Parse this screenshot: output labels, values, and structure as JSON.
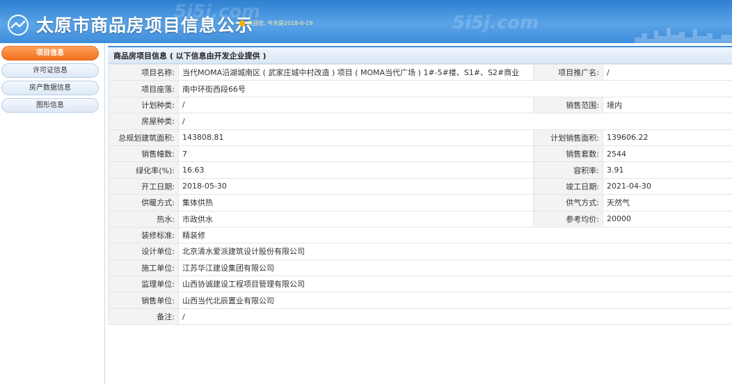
{
  "header": {
    "title": "太原市商品房项目信息公示",
    "welcome": "欢迎您, 今天是2018-6-19",
    "watermark": "5i5j.com"
  },
  "sidebar": {
    "items": [
      {
        "label": "项目信息",
        "active": true
      },
      {
        "label": "许可证信息",
        "active": false
      },
      {
        "label": "房产数据信息",
        "active": false
      },
      {
        "label": "图形信息",
        "active": false
      }
    ]
  },
  "main": {
    "section_title": "商品房项目信息 ( 以下信息由开发企业提供 )",
    "rows": [
      {
        "l1": "项目名称:",
        "v1": "当代MOMA沿湖城南区 ( 武家庄城中村改造 ) 项目 ( MOMA当代广场 ) 1#-5#楼、S1#、S2#商业",
        "l2": "项目推广名:",
        "v2": "/"
      },
      {
        "l1": "项目座落:",
        "v1": "南中环街西段66号"
      },
      {
        "l1": "计划种类:",
        "v1": "/",
        "l2": "销售范围:",
        "v2": "境内"
      },
      {
        "l1": "房屋种类:",
        "v1": "/"
      },
      {
        "l1": "总规划建筑面积:",
        "v1": "143808.81",
        "l2": "计划销售面积:",
        "v2": "139606.22"
      },
      {
        "l1": "销售幢数:",
        "v1": "7",
        "l2": "销售套数:",
        "v2": "2544"
      },
      {
        "l1": "绿化率(%):",
        "v1": "16.63",
        "l2": "容积率:",
        "v2": "3.91"
      },
      {
        "l1": "开工日期:",
        "v1": "2018-05-30",
        "l2": "竣工日期:",
        "v2": "2021-04-30"
      },
      {
        "l1": "供暖方式:",
        "v1": "集体供热",
        "l2": "供气方式:",
        "v2": "天然气"
      },
      {
        "l1": "热水:",
        "v1": "市政供水",
        "l2": "参考均价:",
        "v2": "20000"
      },
      {
        "l1": "装修标准:",
        "v1": "精装修"
      },
      {
        "l1": "设计单位:",
        "v1": "北京清水爱派建筑设计股份有限公司"
      },
      {
        "l1": "施工单位:",
        "v1": "江苏华江建设集团有限公司"
      },
      {
        "l1": "监理单位:",
        "v1": "山西协诚建设工程项目管理有限公司"
      },
      {
        "l1": "销售单位:",
        "v1": "山西当代北辰置业有限公司"
      },
      {
        "l1": "备注:",
        "v1": "/"
      }
    ]
  },
  "colors": {
    "header": "#3f8ddb",
    "active_nav": "#f06f1e",
    "label_bg": "#f3f3f3"
  }
}
